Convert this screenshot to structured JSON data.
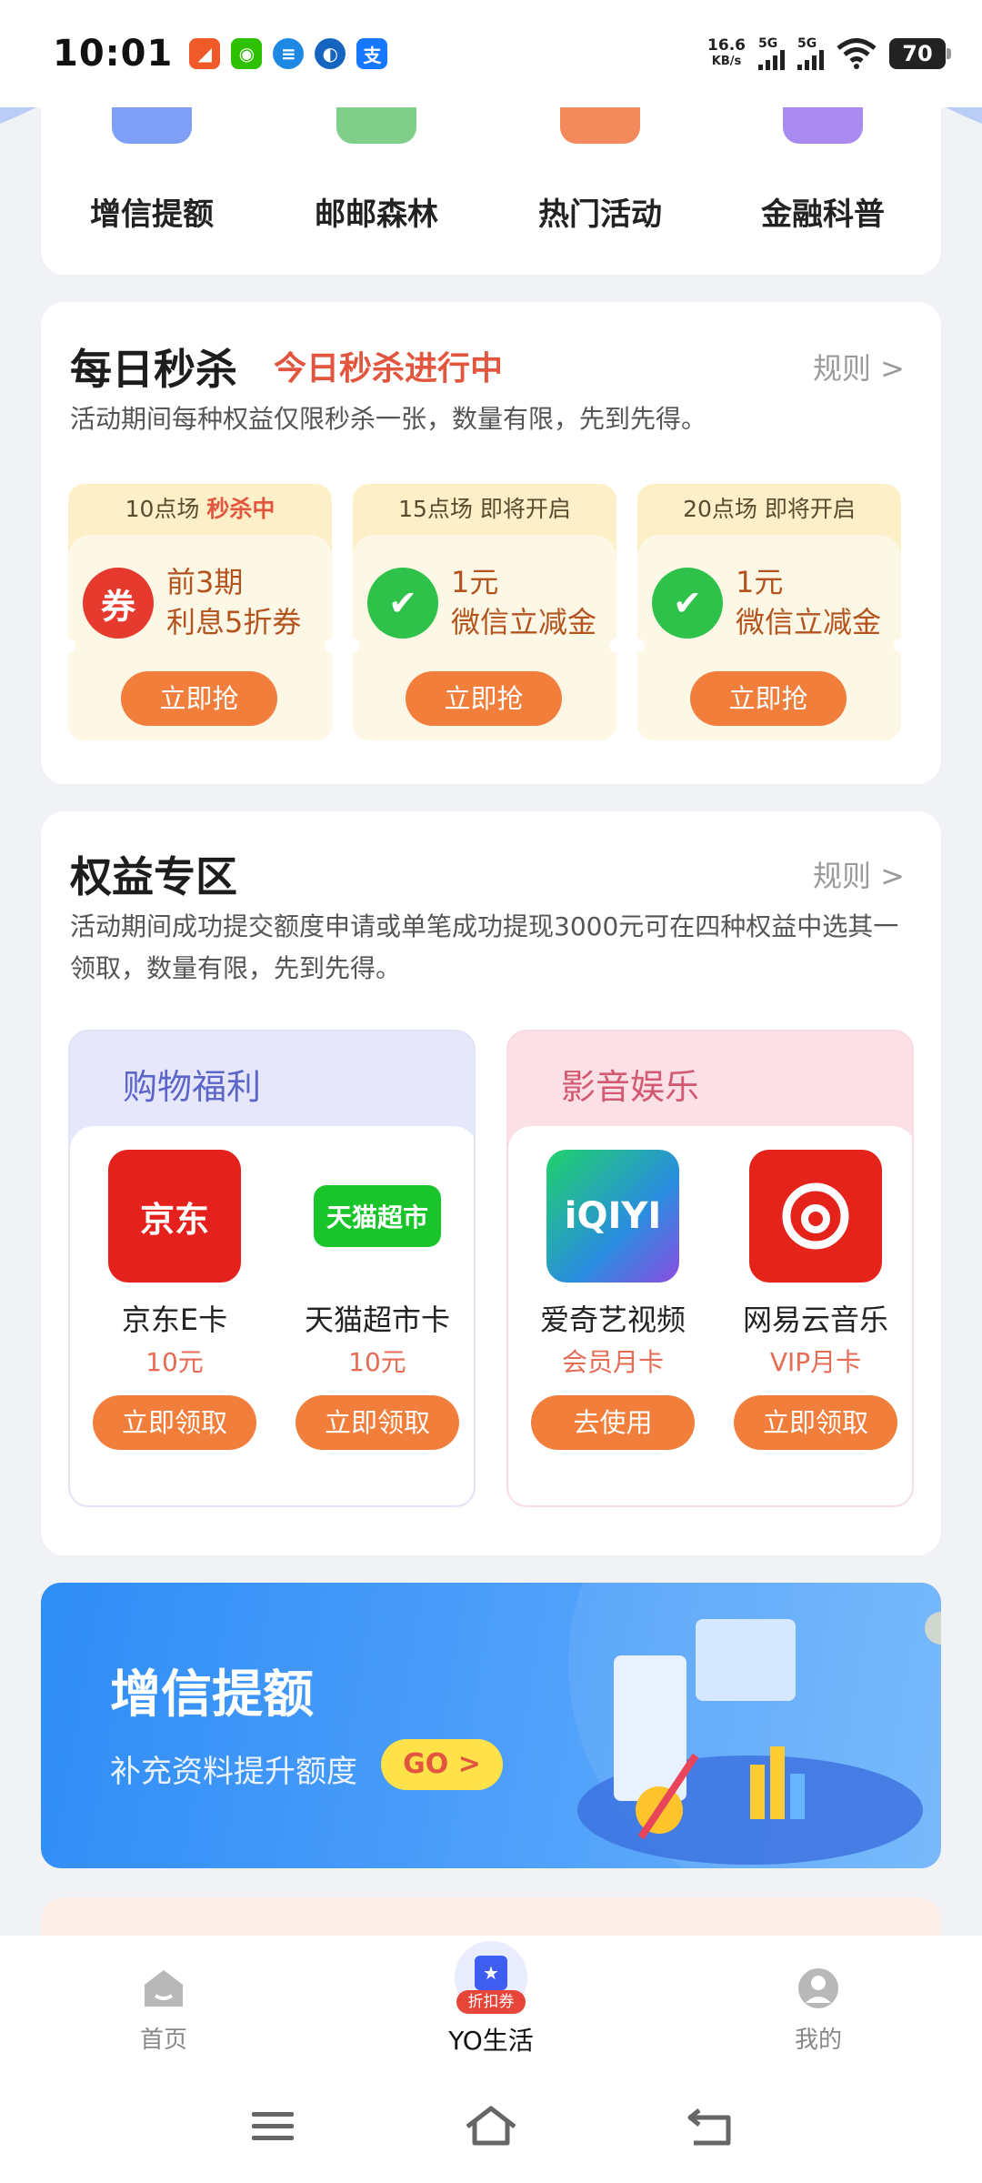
{
  "status_bar": {
    "time": "10:01",
    "net_speed_value": "16.6",
    "net_speed_unit": "KB/s",
    "sim1": "5G",
    "sim2": "5G",
    "battery": "70"
  },
  "quick_menu": [
    {
      "label": "增信提额",
      "icon": "credit-icon",
      "color": "#7f9ef5"
    },
    {
      "label": "邮邮森林",
      "icon": "forest-icon",
      "color": "#7fcf8a"
    },
    {
      "label": "热门活动",
      "icon": "activity-icon",
      "color": "#f28a5c"
    },
    {
      "label": "金融科普",
      "icon": "finance-icon",
      "color": "#a98af0"
    }
  ],
  "flash_sale": {
    "title": "每日秒杀",
    "subtitle": "今日秒杀进行中",
    "rules": "规则 >",
    "desc": "活动期间每种权益仅限秒杀一张，数量有限，先到先得。",
    "sessions": [
      {
        "time": "10点场",
        "status": "秒杀中",
        "line1": "前3期",
        "line2": "利息5折券",
        "button": "立即抢",
        "icon": "coupon-icon"
      },
      {
        "time": "15点场",
        "status": "即将开启",
        "line1": "1元",
        "line2": "微信立减金",
        "button": "立即抢",
        "icon": "wechat-pay-icon"
      },
      {
        "time": "20点场",
        "status": "即将开启",
        "line1": "1元",
        "line2": "微信立减金",
        "button": "立即抢",
        "icon": "wechat-pay-icon"
      }
    ]
  },
  "benefits": {
    "title": "权益专区",
    "rules": "规则 >",
    "desc": "活动期间成功提交额度申请或单笔成功提现3000元可在四种权益中选其一领取，数量有限，先到先得。",
    "groups": [
      {
        "title": "购物福利",
        "items": [
          {
            "name": "京东E卡",
            "value": "10元",
            "button": "立即领取",
            "logo_text": "京东"
          },
          {
            "name": "天猫超市卡",
            "value": "10元",
            "button": "立即领取",
            "logo_text": "天猫超市"
          }
        ]
      },
      {
        "title": "影音娱乐",
        "items": [
          {
            "name": "爱奇艺视频",
            "value": "会员月卡",
            "button": "去使用",
            "logo_text": "iQIYI"
          },
          {
            "name": "网易云音乐",
            "value": "VIP月卡",
            "button": "立即领取",
            "logo_text": ""
          }
        ]
      }
    ]
  },
  "banner": {
    "title": "增信提额",
    "subtitle": "补充资料提升额度",
    "button": "GO >"
  },
  "tabbar": {
    "home": "首页",
    "life": "YO生活",
    "life_badge": "折扣券",
    "mine": "我的"
  },
  "colors": {
    "accent_orange": "#f27e3c",
    "highlight_red": "#e2553f"
  }
}
